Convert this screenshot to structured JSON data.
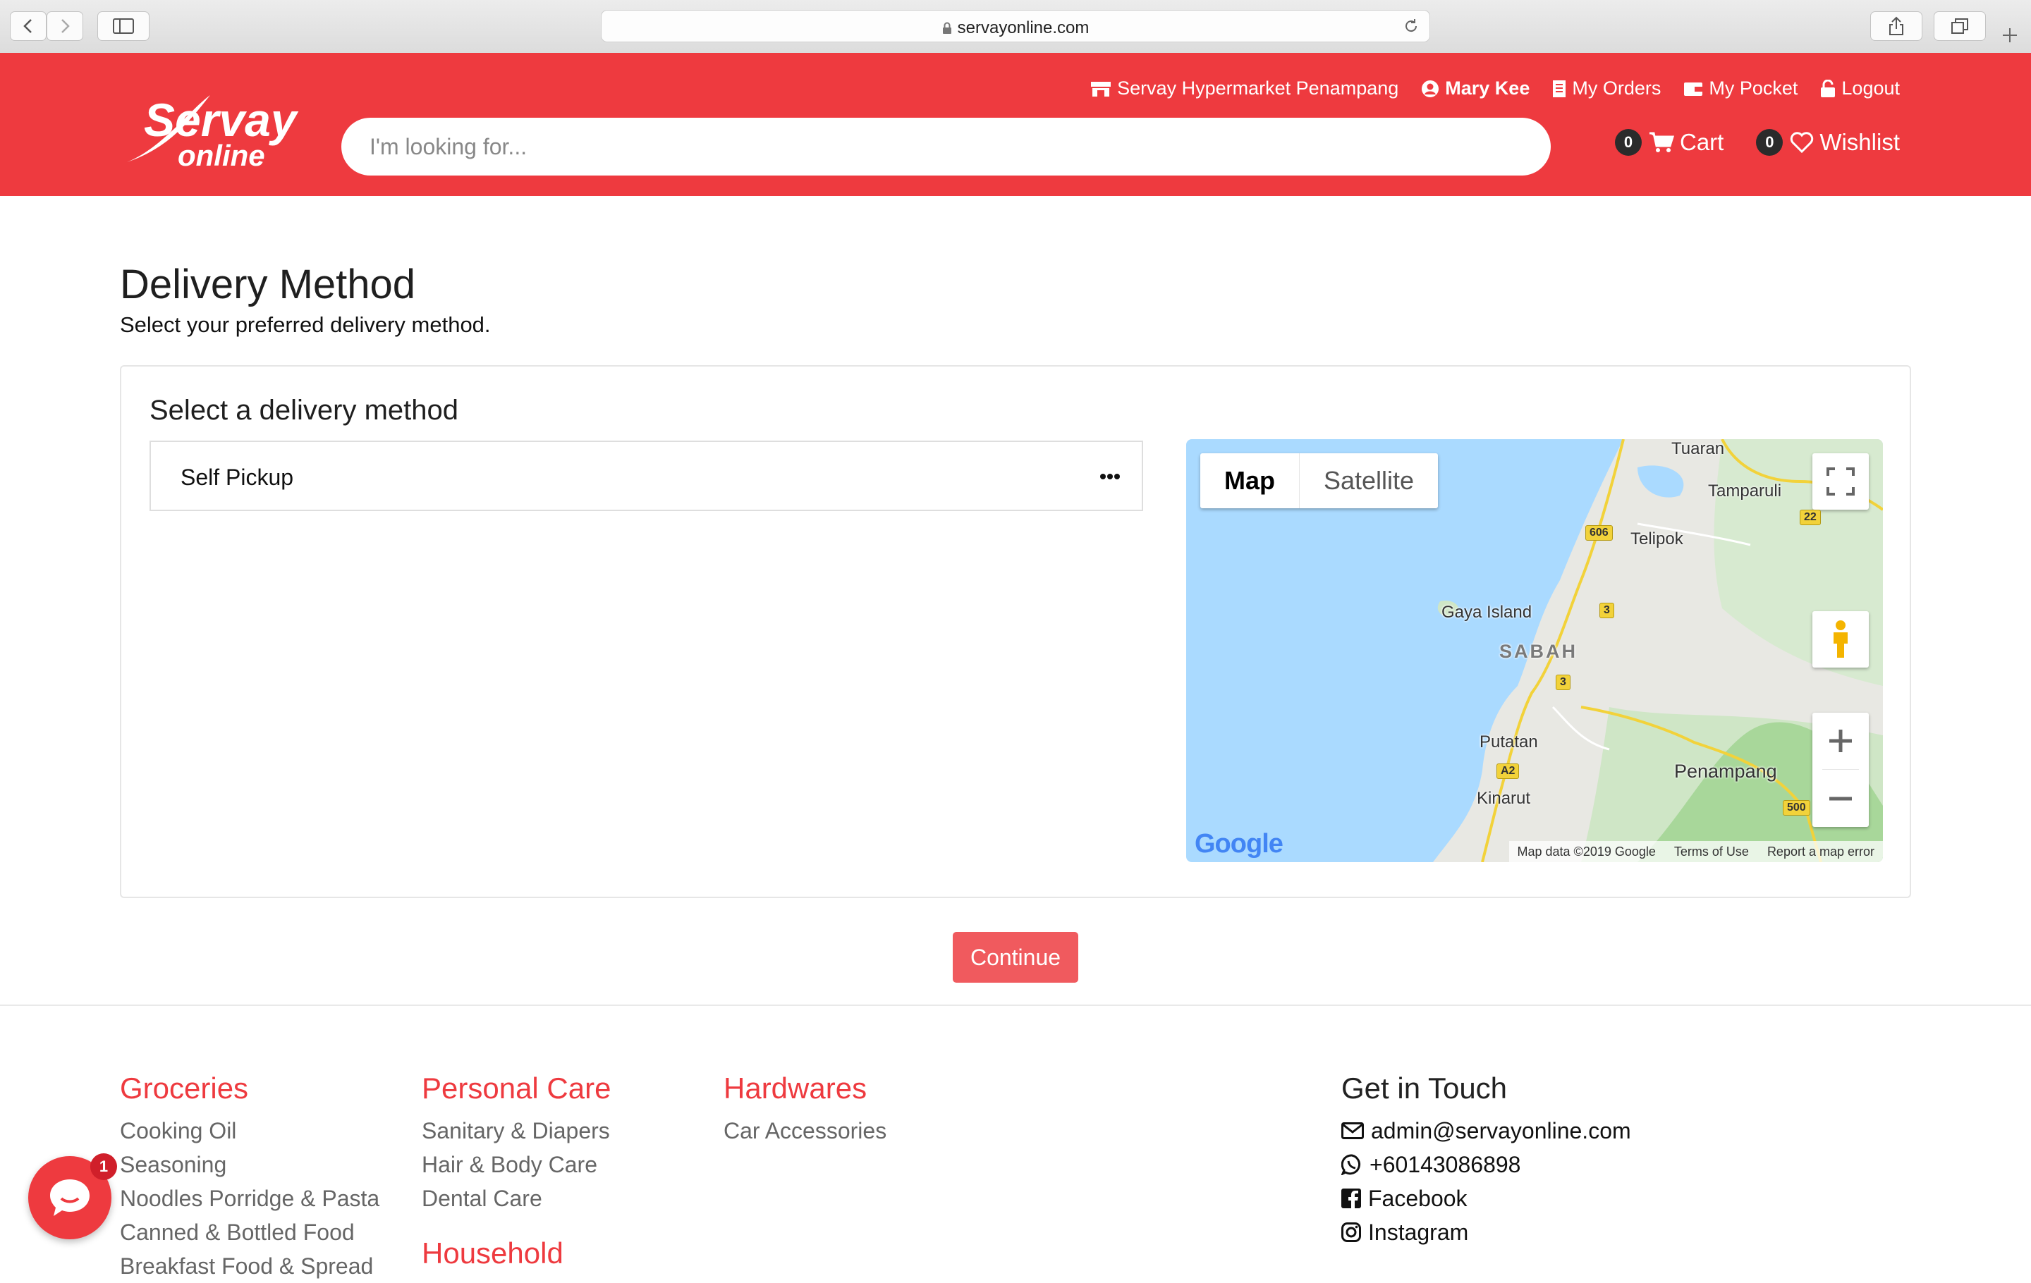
{
  "browser": {
    "url": "servayonline.com"
  },
  "brand": {
    "logo_line1": "Servay",
    "logo_line2": "online",
    "color": "#ee3a3f"
  },
  "header": {
    "search_placeholder": "I'm looking for...",
    "top_links": {
      "store": "Servay Hypermarket Penampang",
      "user": "Mary Kee",
      "orders": "My Orders",
      "pocket": "My Pocket",
      "logout": "Logout"
    },
    "cart": {
      "count": "0",
      "label": "Cart"
    },
    "wishlist": {
      "count": "0",
      "label": "Wishlist"
    }
  },
  "page": {
    "title": "Delivery Method",
    "subtitle": "Select your preferred delivery method."
  },
  "delivery": {
    "heading": "Select a delivery method",
    "options": [
      {
        "label": "Self Pickup"
      }
    ]
  },
  "map": {
    "type_map": "Map",
    "type_satellite": "Satellite",
    "labels": {
      "tuaran": "Tuaran",
      "tamparuli": "Tamparuli",
      "telipok": "Telipok",
      "gaya": "Gaya Island",
      "sabah": "SABAH",
      "putatan": "Putatan",
      "kinarut": "Kinarut",
      "penampang": "Penampang"
    },
    "roads": {
      "r22": "22",
      "r606": "606",
      "r3a": "3",
      "r3b": "3",
      "ra2": "A2",
      "r500": "500"
    },
    "attribution": {
      "data": "Map data ©2019 Google",
      "terms": "Terms of Use",
      "report": "Report a map error"
    },
    "google": "Google"
  },
  "continue_label": "Continue",
  "footer": {
    "groceries": {
      "title": "Groceries",
      "items": [
        "Cooking Oil",
        "Seasoning",
        "Noodles Porridge & Pasta",
        "Canned & Bottled Food",
        "Breakfast Food & Spread"
      ]
    },
    "personal_care": {
      "title": "Personal Care",
      "items": [
        "Sanitary & Diapers",
        "Hair & Body Care",
        "Dental Care"
      ]
    },
    "household": {
      "title": "Household"
    },
    "hardwares": {
      "title": "Hardwares",
      "items": [
        "Car Accessories"
      ]
    },
    "contact": {
      "title": "Get in Touch",
      "email": "admin@servayonline.com",
      "phone": "+60143086898",
      "facebook": "Facebook",
      "instagram": "Instagram"
    }
  },
  "chat": {
    "badge": "1"
  }
}
